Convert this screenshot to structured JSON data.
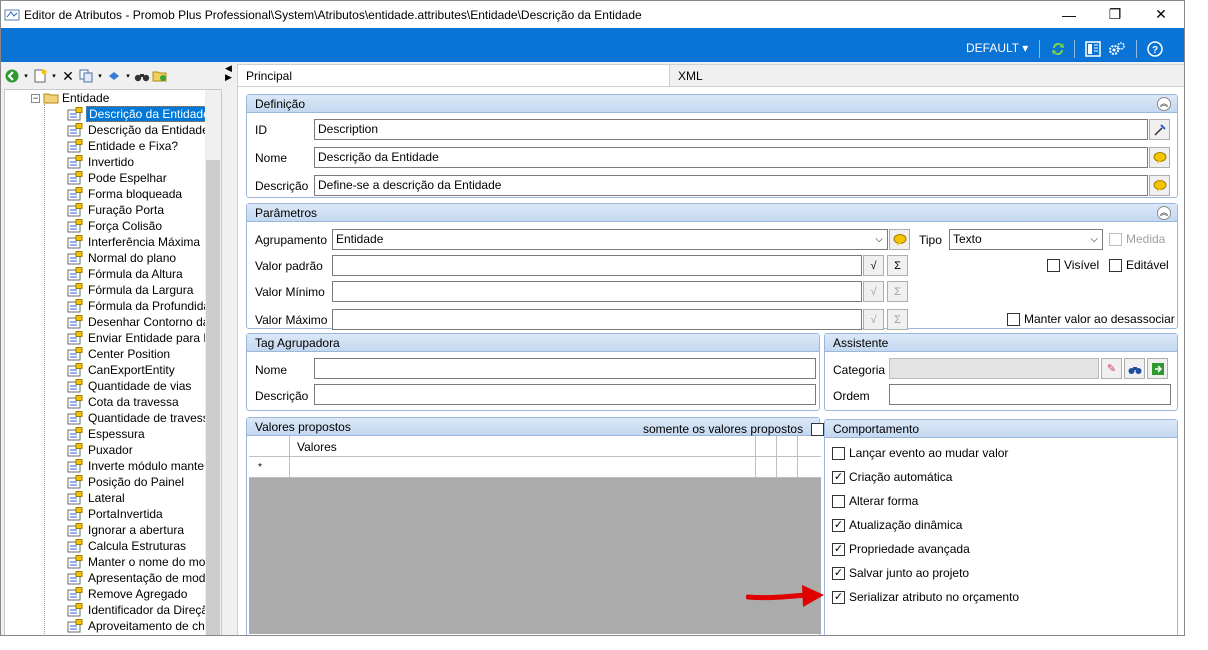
{
  "window": {
    "title": "Editor de Atributos - Promob Plus Professional\\System\\Atributos\\entidade.attributes\\Entidade\\Descrição da Entidade",
    "minimize": "—",
    "maximize": "❐",
    "close": "✕"
  },
  "bluebar": {
    "profile": "DEFAULT ▾",
    "color": "#0a73d6"
  },
  "toolbar_icons": [
    "back-icon",
    "new-icon",
    "delete-icon",
    "copy-icon",
    "move-icon",
    "find-icon",
    "refresh-folder-icon"
  ],
  "tree": {
    "root": "Entidade",
    "items": [
      "Descrição da Entidade",
      "Descrição da Entidade",
      "Entidade e Fixa?",
      "Invertido",
      "Pode Espelhar",
      "Forma bloqueada",
      "Furação Porta",
      "Força Colisão",
      "Interferência Máxima",
      "Normal do plano",
      "Fórmula da Altura",
      "Fórmula da Largura",
      "Fórmula da Profundidade",
      "Desenhar Contorno da M",
      "Enviar Entidade para Dy",
      "Center Position",
      "CanExportEntity",
      "Quantidade de vias",
      "Cota da travessa",
      "Quantidade de travessa",
      "Espessura",
      "Puxador",
      "Inverte módulo mantend",
      "Posição do Painel",
      "Lateral",
      "PortaInvertida",
      "Ignorar a abertura",
      "Calcula Estruturas",
      "Manter o nome do model",
      "Apresentação de modelo",
      "Remove Agregado",
      "Identificador da Direção",
      "Aproveitamento de chap"
    ]
  },
  "tabs": {
    "principal": "Principal",
    "xml": "XML"
  },
  "definicao": {
    "title": "Definição",
    "id_label": "ID",
    "id_value": "Description",
    "nome_label": "Nome",
    "nome_value": "Descrição da Entidade",
    "descricao_label": "Descrição",
    "descricao_value": "Define-se a descrição da Entidade"
  },
  "parametros": {
    "title": "Parâmetros",
    "agrupamento_label": "Agrupamento",
    "agrupamento_value": "Entidade",
    "tipo_label": "Tipo",
    "tipo_value": "Texto",
    "medida_label": "Medida",
    "valor_padrao_label": "Valor padrão",
    "valor_minimo_label": "Valor Mínimo",
    "valor_maximo_label": "Valor Máximo",
    "visivel_label": "Visível",
    "editavel_label": "Editável",
    "manter_label": "Manter valor ao desassociar"
  },
  "tag": {
    "title": "Tag Agrupadora",
    "nome_label": "Nome",
    "descricao_label": "Descrição"
  },
  "assistente": {
    "title": "Assistente",
    "categoria_label": "Categoria",
    "ordem_label": "Ordem"
  },
  "valores": {
    "title": "Valores propostos",
    "somente_label": "somente os valores propostos",
    "col_valores": "Valores",
    "new_row_marker": "*"
  },
  "comportamento": {
    "title": "Comportamento",
    "items": [
      {
        "label": "Lançar evento ao mudar valor",
        "checked": false
      },
      {
        "label": "Criação automática",
        "checked": true
      },
      {
        "label": "Alterar forma",
        "checked": false
      },
      {
        "label": "Atualização dinâmica",
        "checked": true
      },
      {
        "label": "Propriedade avançada",
        "checked": true
      },
      {
        "label": "Salvar junto ao projeto",
        "checked": true
      },
      {
        "label": "Serializar atributo no orçamento",
        "checked": true
      }
    ]
  },
  "annotation_arrow_color": "#e00000"
}
